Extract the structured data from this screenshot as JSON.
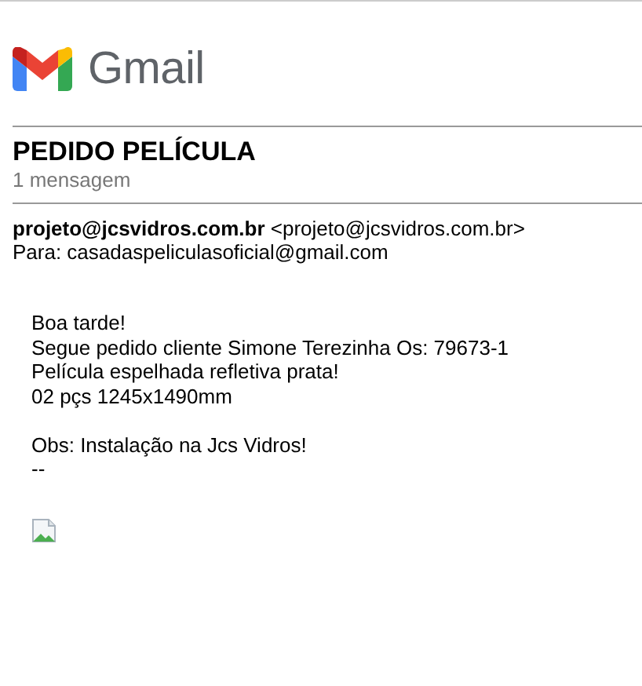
{
  "header": {
    "brand": "Gmail"
  },
  "thread": {
    "subject": "PEDIDO PELÍCULA",
    "count": "1 mensagem"
  },
  "message": {
    "sender_name": "projeto@jcsvidros.com.br",
    "sender_address": "<projeto@jcsvidros.com.br>",
    "recipient": "Para: casadaspeliculasoficial@gmail.com",
    "paragraphs": [
      [
        "Boa tarde!",
        "Segue pedido cliente Simone Terezinha Os: 79673-1",
        "Película espelhada refletiva prata!",
        "02 pçs 1245x1490mm"
      ],
      [
        "Obs: Instalação na Jcs Vidros!",
        "--"
      ]
    ]
  }
}
